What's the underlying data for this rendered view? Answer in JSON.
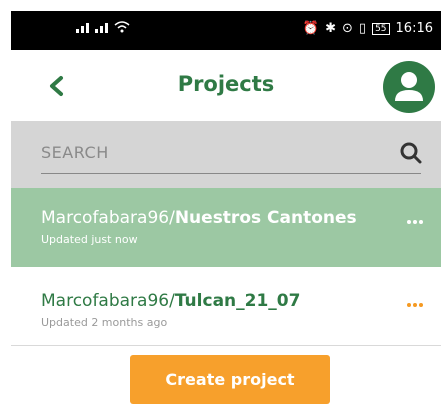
{
  "status": {
    "battery": "55",
    "time": "16:16"
  },
  "header": {
    "title": "Projects",
    "back_icon": "chevron-left-icon",
    "avatar_icon": "user-avatar-icon"
  },
  "search": {
    "placeholder": "SEARCH",
    "icon": "search-icon"
  },
  "projects": [
    {
      "owner": "Marcofabara96/",
      "name": "Nuestros Cantones",
      "updated": "Updated just now",
      "selected": true
    },
    {
      "owner": "Marcofabara96/",
      "name": "Tulcan_21_07",
      "updated": "Updated 2 months ago",
      "selected": false
    }
  ],
  "actions": {
    "create_label": "Create project"
  },
  "colors": {
    "brand_green": "#2f7a45",
    "selected_row": "#9cc8a3",
    "accent_orange": "#f7a02c"
  }
}
